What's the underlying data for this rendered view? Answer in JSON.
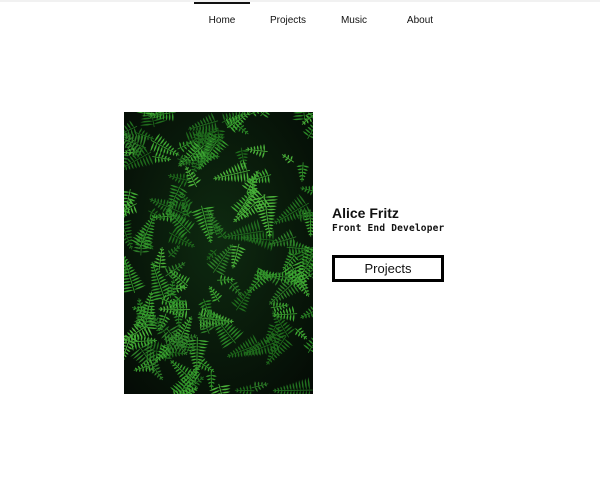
{
  "nav": {
    "items": [
      {
        "label": "Home",
        "active": true
      },
      {
        "label": "Projects",
        "active": false
      },
      {
        "label": "Music",
        "active": false
      },
      {
        "label": "About",
        "active": false
      }
    ]
  },
  "hero": {
    "image_description": "fern-foliage-photo",
    "name": "Alice Fritz",
    "role": "Front End Developer",
    "cta_label": "Projects"
  },
  "colors": {
    "text": "#111111",
    "button_border": "#000000",
    "image_dark": "#07160a",
    "fern_green": "#2f8f2a"
  }
}
